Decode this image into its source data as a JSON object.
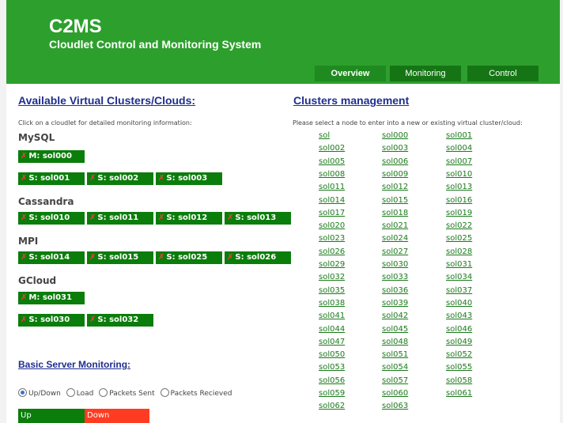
{
  "header": {
    "title": "C2MS",
    "subtitle": "Cloudlet Control and Monitoring System",
    "nav": [
      "Overview",
      "Monitoring",
      "Control"
    ],
    "bg_color": "#2d9f2d"
  },
  "left": {
    "heading": "Available Virtual Clusters/Clouds:",
    "note": "Click on a cloudlet for detailed monitoring information:",
    "groups": [
      {
        "name": "MySQL",
        "nodes": [
          "M: sol000",
          "S: sol001",
          "S: sol002",
          "S: sol003"
        ]
      },
      {
        "name": "Cassandra",
        "nodes": [
          "S: sol010",
          "S: sol011",
          "S: sol012",
          "S: sol013"
        ]
      },
      {
        "name": "MPI",
        "nodes": [
          "S: sol014",
          "S: sol015",
          "S: sol025",
          "S: sol026"
        ]
      },
      {
        "name": "GCloud",
        "nodes": [
          "M: sol031",
          "S: sol030",
          "S: sol032"
        ]
      }
    ],
    "remove_icon": "x-remove-icon",
    "monitoring": {
      "heading": "Basic Server Monitoring:",
      "options": [
        "Up/Down",
        "Load",
        "Packets Sent",
        "Packets Recieved"
      ],
      "selected": "Up/Down",
      "legend": {
        "up": "Up",
        "down": "Down",
        "up_color": "#0b7d0b",
        "down_color": "#ff3b22"
      }
    }
  },
  "right": {
    "heading": "Clusters management",
    "note": "Please select a node to enter into a new or existing virtual cluster/cloud:",
    "nodes": [
      [
        "sol",
        "sol000",
        "sol001"
      ],
      [
        "sol002",
        "sol003",
        "sol004"
      ],
      [
        "sol005",
        "sol006",
        "sol007"
      ],
      [
        "sol008",
        "sol009",
        "sol010"
      ],
      [
        "sol011",
        "sol012",
        "sol013"
      ],
      [
        "sol014",
        "sol015",
        "sol016"
      ],
      [
        "sol017",
        "sol018",
        "sol019"
      ],
      [
        "sol020",
        "sol021",
        "sol022"
      ],
      [
        "sol023",
        "sol024",
        "sol025"
      ],
      [
        "sol026",
        "sol027",
        "sol028"
      ],
      [
        "sol029",
        "sol030",
        "sol031"
      ],
      [
        "sol032",
        "sol033",
        "sol034"
      ],
      [
        "sol035",
        "sol036",
        "sol037"
      ],
      [
        "sol038",
        "sol039",
        "sol040"
      ],
      [
        "sol041",
        "sol042",
        "sol043"
      ],
      [
        "sol044",
        "sol045",
        "sol046"
      ],
      [
        "sol047",
        "sol048",
        "sol049"
      ],
      [
        "sol050",
        "sol051",
        "sol052"
      ],
      [
        "sol053",
        "sol054",
        "sol055"
      ],
      [
        "sol056",
        "sol057",
        "sol058"
      ],
      [
        "sol059",
        "sol060",
        "sol061"
      ],
      [
        "sol062",
        "sol063"
      ]
    ]
  }
}
